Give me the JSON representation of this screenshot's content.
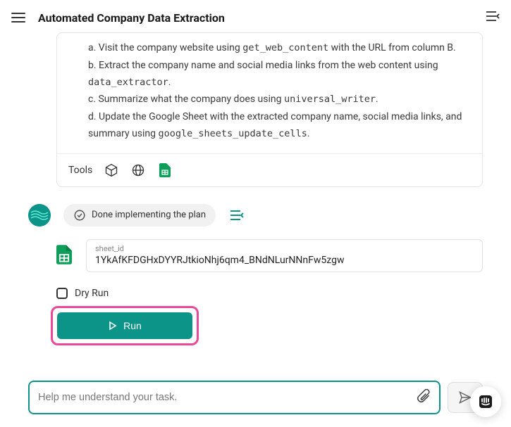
{
  "header": {
    "title": "Automated Company Data Extraction"
  },
  "task": {
    "steps": {
      "a_pre": "a. Visit the company website using ",
      "a_code": "get_web_content",
      "a_post": " with the URL from column B.",
      "b_pre": "b. Extract the company name and social media links from the web content using ",
      "b_code": "data_extractor",
      "b_post": ".",
      "c_pre": "c. Summarize what the company does using ",
      "c_code": "universal_writer",
      "c_post": ".",
      "d_pre": "d. Update the Google Sheet with the extracted company name, social media links, and summary using ",
      "d_code": "google_sheets_update_cells",
      "d_post": "."
    },
    "tools_label": "Tools"
  },
  "status": {
    "text": "Done implementing the plan"
  },
  "sheet": {
    "label": "sheet_id",
    "value": "1YkAfKFDGHxDYYRJtkioNhj6qm4_BNdNLurNNnFw5zgw"
  },
  "run": {
    "dry_run_label": "Dry Run",
    "button_label": "Run"
  },
  "chat": {
    "placeholder": "Help me understand your task."
  }
}
